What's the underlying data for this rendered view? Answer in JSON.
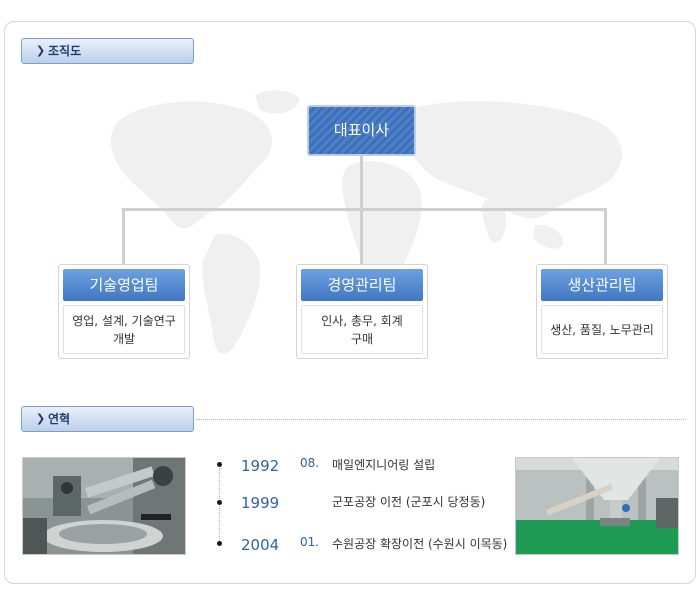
{
  "sections": {
    "org_chart_title": "조직도",
    "history_title": "연혁"
  },
  "org": {
    "ceo": "대표이사",
    "teams": [
      {
        "name": "기술영업팀",
        "duty_line1": "영업, 설계, 기술연구",
        "duty_line2": "개발"
      },
      {
        "name": "경영관리팀",
        "duty_line1": "인사, 총무, 회계",
        "duty_line2": "구매"
      },
      {
        "name": "생산관리팀",
        "duty_line1": "생산, 품질, 노무관리",
        "duty_line2": ""
      }
    ]
  },
  "history": [
    {
      "year": "1992",
      "month": "08.",
      "event": "매일엔지니어링 설립"
    },
    {
      "year": "1999",
      "month": "",
      "event": "군포공장 이전 (군포시 당정동)"
    },
    {
      "year": "2004",
      "month": "01.",
      "event": "수원공장 확장이전 (수원시 이목동)"
    }
  ],
  "colors": {
    "accent_blue": "#3f77c2",
    "text_blue": "#2e62a8",
    "factory_floor_green": "#1f9a55"
  },
  "icons": {
    "section_marker": "chevron-right-icon"
  }
}
